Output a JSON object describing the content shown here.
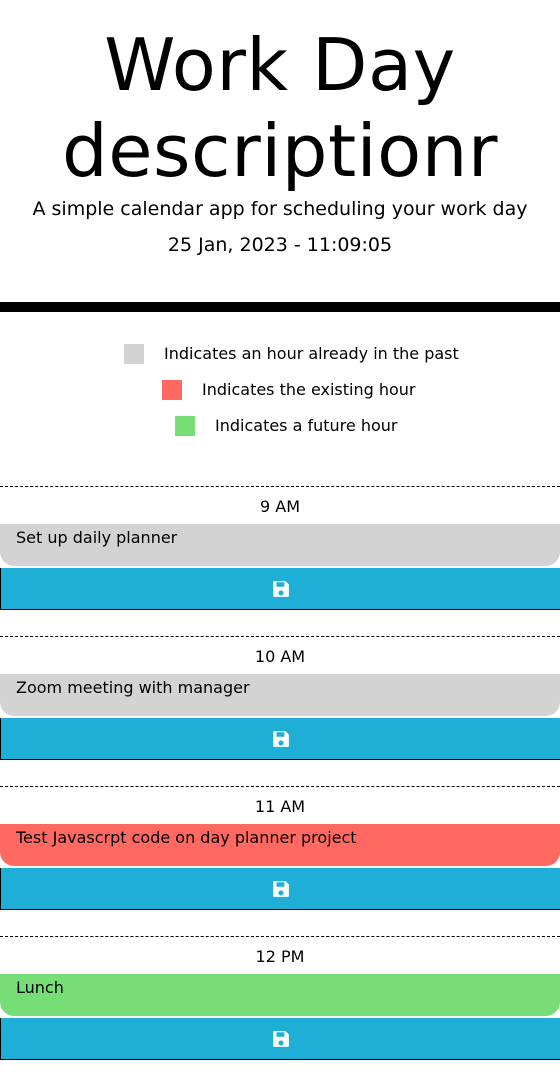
{
  "header": {
    "title": "Work Day descriptionr",
    "lead": "A simple calendar app for scheduling your work day",
    "current_day": "25 Jan, 2023 - 11:09:05"
  },
  "legend": {
    "past": {
      "label": "Indicates an hour already in the past",
      "color": "#d3d3d3"
    },
    "present": {
      "label": "Indicates the existing hour",
      "color": "#ff6961"
    },
    "future": {
      "label": "Indicates a future hour",
      "color": "#77dd77"
    }
  },
  "save_button": {
    "icon": "save-icon",
    "color": "#1fafd6"
  },
  "timeblocks": [
    {
      "hour": "9 AM",
      "text": "Set up daily planner",
      "state": "past"
    },
    {
      "hour": "10 AM",
      "text": "Zoom meeting with manager",
      "state": "past"
    },
    {
      "hour": "11 AM",
      "text": "Test Javascrpt code on day planner project",
      "state": "present"
    },
    {
      "hour": "12 PM",
      "text": "Lunch",
      "state": "future"
    }
  ]
}
